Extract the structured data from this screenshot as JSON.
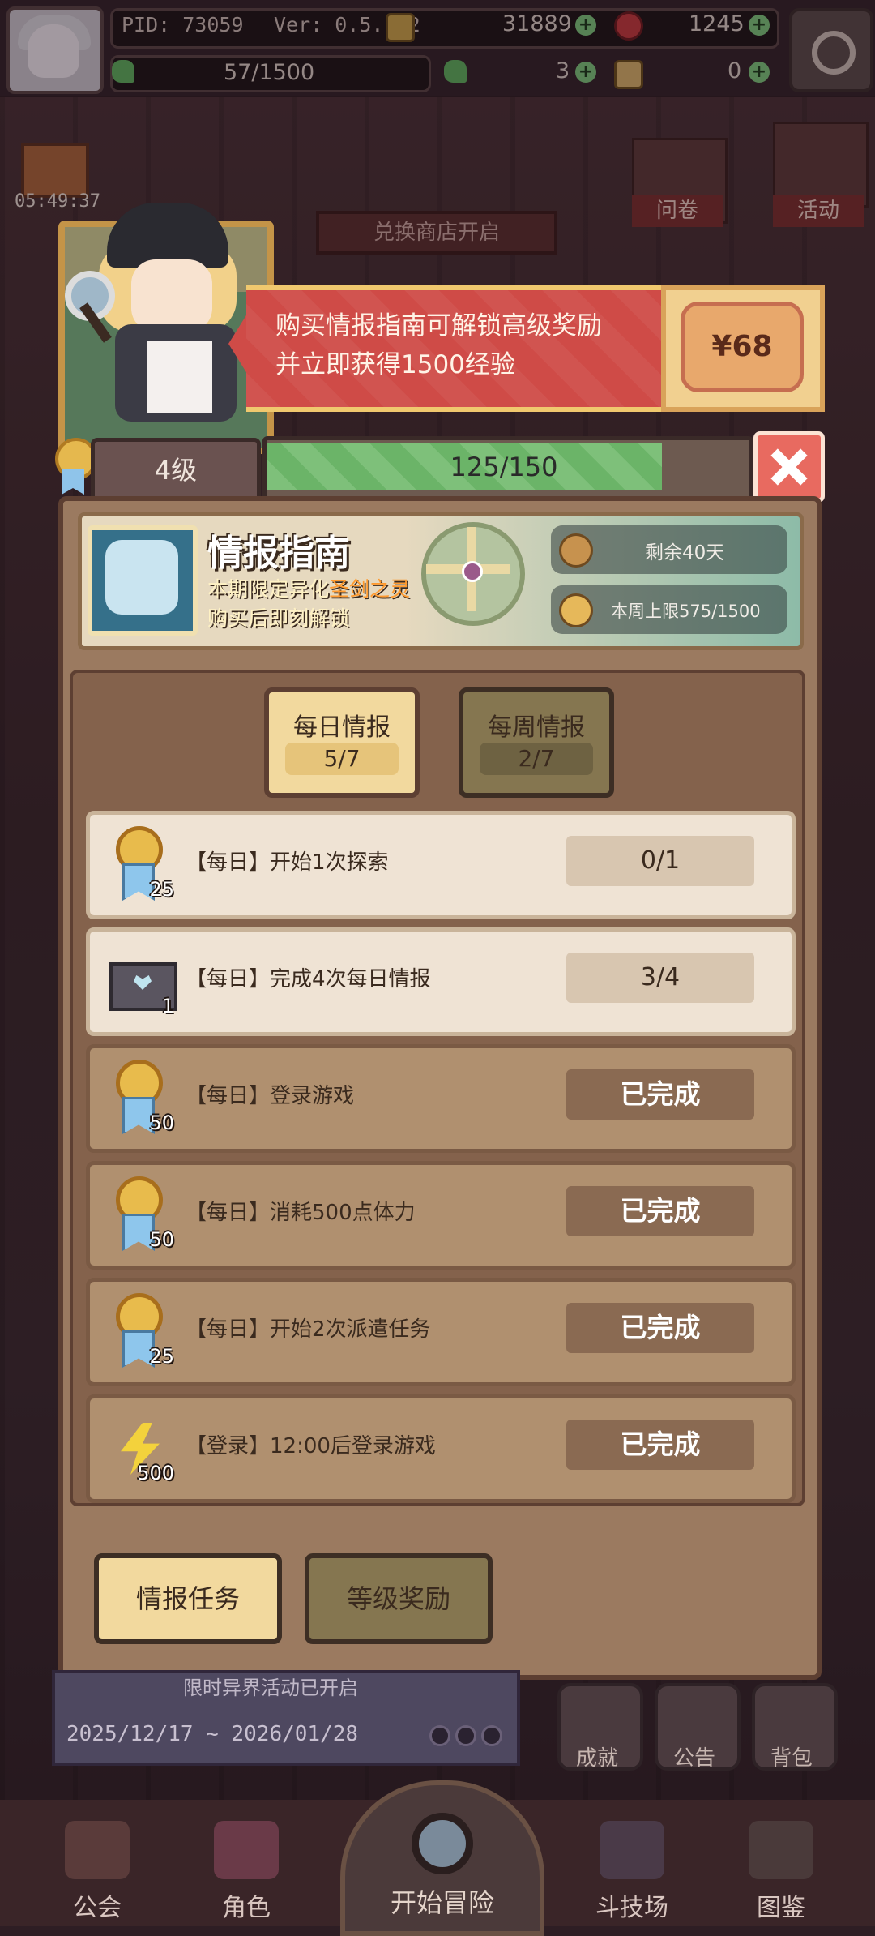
{
  "topbar": {
    "pid": "PID: 73059",
    "version": "Ver: 0.5.1.2",
    "energy": "57/1500",
    "gold": "31889",
    "gems": "1245",
    "clover": "3",
    "key": "0"
  },
  "background": {
    "timer": "05:49:37",
    "exchange_shop": "兑换商店开启",
    "survey_label": "问卷",
    "activity_label": "活动",
    "event_text": "限时异界活动已开启",
    "event_dates": "2025/12/17 ~ 2026/01/28",
    "achievement_label": "成就",
    "notice_label": "公告",
    "bag_label": "背包"
  },
  "promo": {
    "line1": "购买情报指南可解锁高级奖励",
    "line2": "并立即获得1500经验",
    "price": "¥68"
  },
  "level": {
    "label": "4级",
    "xp_text": "125/150",
    "xp_current": 125,
    "xp_max": 150
  },
  "guide": {
    "title": "情报指南",
    "sub_prefix": "本期限定异化",
    "sub_highlight": "圣剑之灵",
    "sub2": "购买后即刻解锁",
    "days_left": "剩余40天",
    "weekly_cap": "本周上限575/1500"
  },
  "tabs": [
    {
      "label": "每日情报",
      "count": "5/7",
      "active": true
    },
    {
      "label": "每周情报",
      "count": "2/7",
      "active": false
    }
  ],
  "tasks": [
    {
      "label": "【每日】开始1次探索",
      "reward": "medal",
      "reward_count": "25",
      "status": "0/1",
      "done": false
    },
    {
      "label": "【每日】完成4次每日情报",
      "reward": "envelope",
      "reward_count": "1",
      "status": "3/4",
      "done": false
    },
    {
      "label": "【每日】登录游戏",
      "reward": "medal",
      "reward_count": "50",
      "status": "已完成",
      "done": true
    },
    {
      "label": "【每日】消耗500点体力",
      "reward": "medal",
      "reward_count": "50",
      "status": "已完成",
      "done": true
    },
    {
      "label": "【每日】开始2次派遣任务",
      "reward": "medal",
      "reward_count": "25",
      "status": "已完成",
      "done": true
    },
    {
      "label": "【登录】12:00后登录游戏",
      "reward": "bolt",
      "reward_count": "500",
      "status": "已完成",
      "done": true
    }
  ],
  "footer_buttons": {
    "tasks": "情报任务",
    "level_rewards": "等级奖励"
  },
  "nav": {
    "guild": "公会",
    "character": "角色",
    "start": "开始冒险",
    "arena": "斗技场",
    "codex": "图鉴"
  },
  "colors": {
    "promo_red": "#cf4b47",
    "xp_green": "#7ec07a",
    "gold_tab": "#f2d99e",
    "done_row": "#b0906f",
    "open_row": "#efe3d4"
  }
}
